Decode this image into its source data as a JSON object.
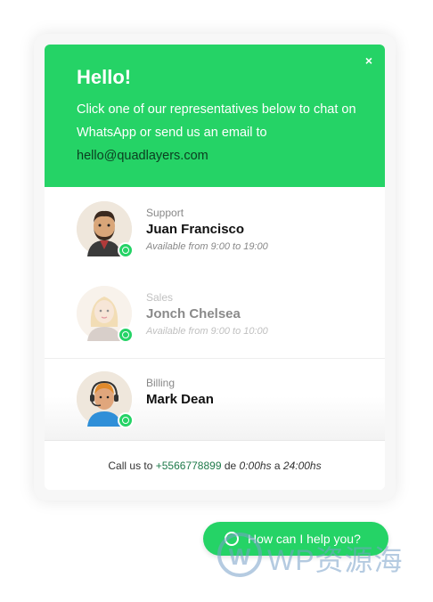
{
  "header": {
    "close": "×",
    "title": "Hello!",
    "intro": "Click one of our representatives below to chat on WhatsApp or send us an email to",
    "email": "hello@quadlayers.com"
  },
  "agents": [
    {
      "role": "Support",
      "name": "Juan Francisco",
      "availability": "Available from 9:00 to 19:00"
    },
    {
      "role": "Sales",
      "name": "Jonch Chelsea",
      "availability": "Available from 9:00 to 10:00"
    },
    {
      "role": "Billing",
      "name": "Mark Dean",
      "availability": ""
    }
  ],
  "footer": {
    "prefix": "Call us to ",
    "phone": "+5566778899",
    "mid": " de ",
    "from": "0:00hs",
    "a": " a ",
    "to": "24:00hs"
  },
  "cta": {
    "label": "How can I help you?"
  },
  "watermark": {
    "text": "WP资源海",
    "logo_letter": "W"
  },
  "colors": {
    "accent": "#25d366",
    "email": "#0b3d20",
    "phone": "#1e7a4a"
  }
}
